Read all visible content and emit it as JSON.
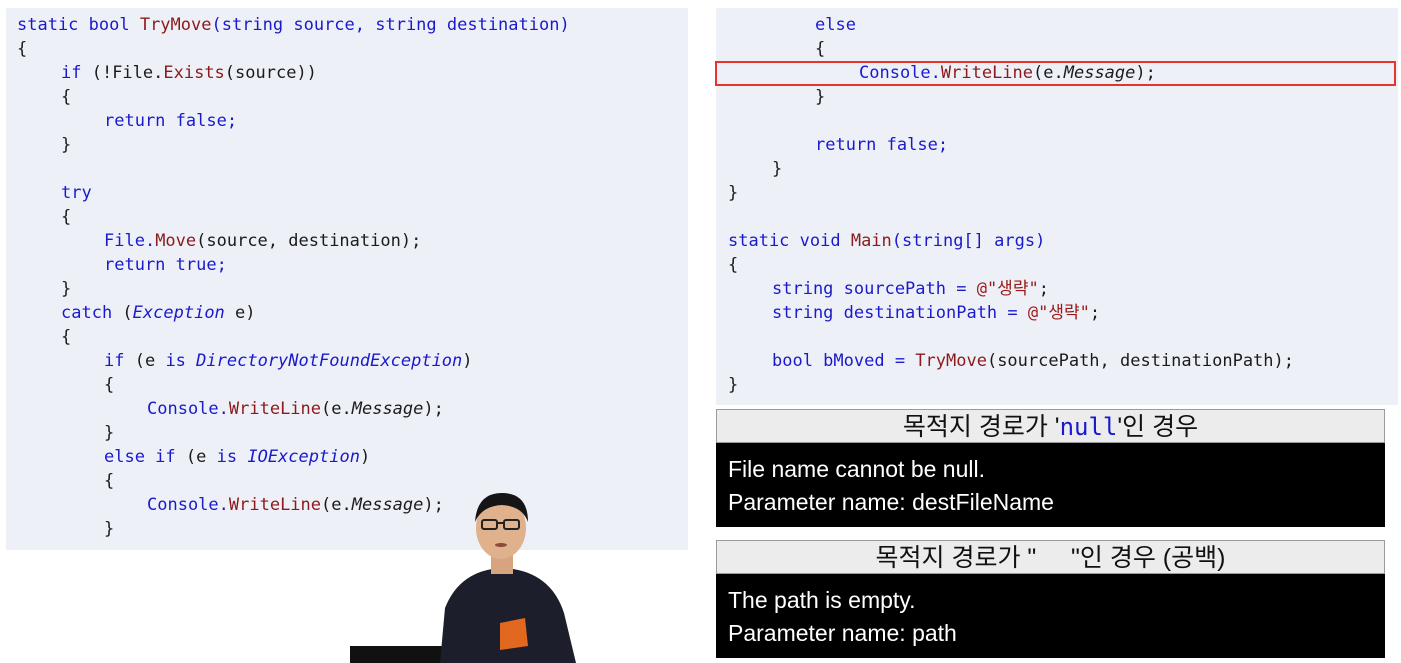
{
  "left_code": {
    "l1": {
      "p1": "static bool ",
      "fn": "TryMove",
      "p2": "(string source, string destination)"
    },
    "l2": "{",
    "l3": {
      "kw": "if",
      "p1": " (!File.",
      "fn": "Exists",
      "p2": "(source))"
    },
    "l4": "{",
    "l5": "return false;",
    "l6": "}",
    "l7": "try",
    "l8": "{",
    "l9": {
      "p1": "File.",
      "fn": "Move",
      "p2": "(source, destination);"
    },
    "l10": "return true;",
    "l11": "}",
    "l12": {
      "kw": "catch",
      "p1": " (",
      "ty": "Exception",
      "p2": " e)"
    },
    "l13": "{",
    "l14": {
      "kw": "if",
      "p1": " (e ",
      "kw2": "is",
      "sp": " ",
      "ty": "DirectoryNotFoundException",
      "p2": ")"
    },
    "l15": "{",
    "l16": {
      "p1": "Console.",
      "fn": "WriteLine",
      "p2": "(e.",
      "pr": "Message",
      "p3": ");"
    },
    "l17": "}",
    "l18": {
      "kw": "else if",
      "p1": " (e ",
      "kw2": "is",
      "sp": " ",
      "ty": "IOException",
      "p2": ")"
    },
    "l19": "{",
    "l20": {
      "p1": "Console.",
      "fn": "WriteLine",
      "p2": "(e.",
      "pr": "Message",
      "p3": ");"
    },
    "l21": "}"
  },
  "right_code": {
    "r1": "else",
    "r2": "{",
    "r3": {
      "p1": "Console.",
      "fn": "WriteLine",
      "p2": "(e.",
      "pr": "Message",
      "p3": ");"
    },
    "r4": "}",
    "r6": "return false;",
    "r7": "}",
    "r8": "}",
    "r10": {
      "p1": "static void ",
      "fn": "Main",
      "p2": "(string[] args)"
    },
    "r11": "{",
    "r12": {
      "p1": "string sourcePath = ",
      "st": "@\"생략\"",
      "p2": ";"
    },
    "r13": {
      "p1": "string destinationPath = ",
      "st": "@\"생략\"",
      "p2": ";"
    },
    "r15": {
      "p1": "bool bMoved = ",
      "fn": "TryMove",
      "p2": "(sourcePath, destinationPath);"
    },
    "r16": "}"
  },
  "message_boxes": [
    {
      "header_pre": "목적지 경로가 '",
      "header_kw": "null",
      "header_post": "'인 경우",
      "line1": "File name cannot be null.",
      "line2": "Parameter name: destFileName"
    },
    {
      "header": "목적지 경로가 \"     \"인 경우 (공백)",
      "line1": "The path is empty.",
      "line2": "Parameter name: path"
    }
  ],
  "colors": {
    "keyword": "#1a1acc",
    "method": "#8b1a1a",
    "highlight_border": "#e8332b",
    "panel_bg": "#eef0f8"
  }
}
